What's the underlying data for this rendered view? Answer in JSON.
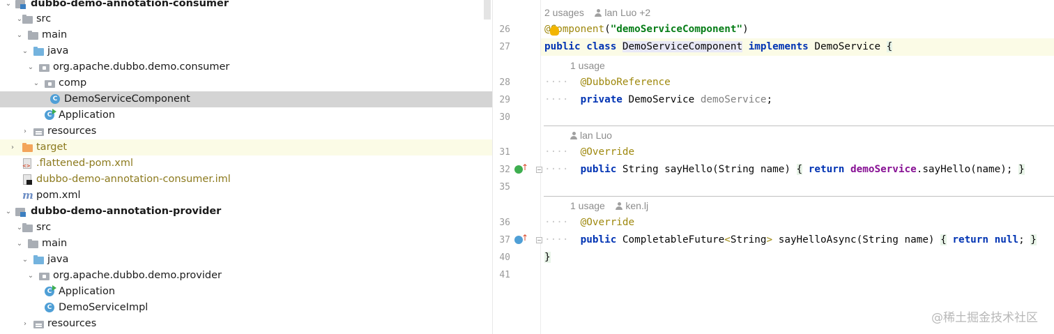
{
  "tree": {
    "items": [
      {
        "label": "dubbo-demo-annotation-consumer",
        "icon": "module-icon"
      },
      {
        "label": "src",
        "icon": "folder-icon"
      },
      {
        "label": "main",
        "icon": "folder-icon"
      },
      {
        "label": "java",
        "icon": "source-folder-icon"
      },
      {
        "label": "org.apache.dubbo.demo.consumer",
        "icon": "package-icon"
      },
      {
        "label": "comp",
        "icon": "package-icon"
      },
      {
        "label": "DemoServiceComponent",
        "icon": "class-icon",
        "badge": "C"
      },
      {
        "label": "Application",
        "icon": "runnable-class-icon",
        "badge": "C"
      },
      {
        "label": "resources",
        "icon": "resources-folder-icon"
      },
      {
        "label": "target",
        "icon": "excluded-folder-icon"
      },
      {
        "label": ".flattened-pom.xml",
        "icon": "xml-file-icon"
      },
      {
        "label": "dubbo-demo-annotation-consumer.iml",
        "icon": "iml-file-icon"
      },
      {
        "label": "pom.xml",
        "icon": "maven-icon",
        "glyph": "m"
      },
      {
        "label": "dubbo-demo-annotation-provider",
        "icon": "module-icon"
      },
      {
        "label": "src",
        "icon": "folder-icon"
      },
      {
        "label": "main",
        "icon": "folder-icon"
      },
      {
        "label": "java",
        "icon": "source-folder-icon"
      },
      {
        "label": "org.apache.dubbo.demo.provider",
        "icon": "package-icon"
      },
      {
        "label": "Application",
        "icon": "runnable-class-icon",
        "badge": "C"
      },
      {
        "label": "DemoServiceImpl",
        "icon": "class-icon",
        "badge": "C"
      },
      {
        "label": "resources",
        "icon": "resources-folder-icon"
      }
    ]
  },
  "editor": {
    "hints": {
      "h1_usages": "2 usages",
      "h1_author": "lan Luo +2",
      "h2_usages": "1 usage",
      "h3_author": "lan Luo",
      "h4_usages": "1 usage",
      "h4_author": "ken.lj"
    },
    "line_numbers": {
      "l26": "26",
      "l27": "27",
      "l28": "28",
      "l29": "29",
      "l30": "30",
      "l31": "31",
      "l32": "32",
      "l35": "35",
      "l36": "36",
      "l37": "37",
      "l40": "40",
      "l41": "41"
    },
    "code": {
      "l26_at": "@",
      "l26_ann": "Component",
      "l26_paren_open": "(",
      "l26_str": "\"demoServiceComponent\"",
      "l26_paren_close": ")",
      "l27_public": "public",
      "l27_class": "class",
      "l27_name": "DemoServiceComponent",
      "l27_implements": "implements",
      "l27_iface": "DemoService",
      "l27_brace": "{",
      "l28_dots": "····",
      "l28_ann": "@DubboReference",
      "l29_dots": "····",
      "l29_private": "private",
      "l29_type": "DemoService",
      "l29_field": "demoService",
      "l29_semi": ";",
      "l31_dots": "····",
      "l31_ann": "@Override",
      "l32_dots": "····",
      "l32_public": "public",
      "l32_sig": "String sayHello(String name)",
      "l32_open": "{",
      "l32_return": "return",
      "l32_field": "demoService",
      "l32_call": ".sayHello(name);",
      "l32_close": "}",
      "l36_dots": "····",
      "l36_ann": "@Override",
      "l37_dots": "····",
      "l37_public": "public",
      "l37_type": "CompletableFuture",
      "l37_lt": "<",
      "l37_gen": "String",
      "l37_gt": ">",
      "l37_sig": "sayHelloAsync(String name)",
      "l37_open": "{",
      "l37_return": "return",
      "l37_null": "null",
      "l37_semi": ";",
      "l37_close": "}",
      "l40_brace": "}"
    }
  },
  "watermark": "@稀土掘金技术社区",
  "colors": {
    "keyword": "#0033b3",
    "string": "#067d17",
    "annotation": "#9e880d",
    "field": "#871094",
    "selection": "#d4d4d4",
    "current_line": "#fbfbe6"
  }
}
